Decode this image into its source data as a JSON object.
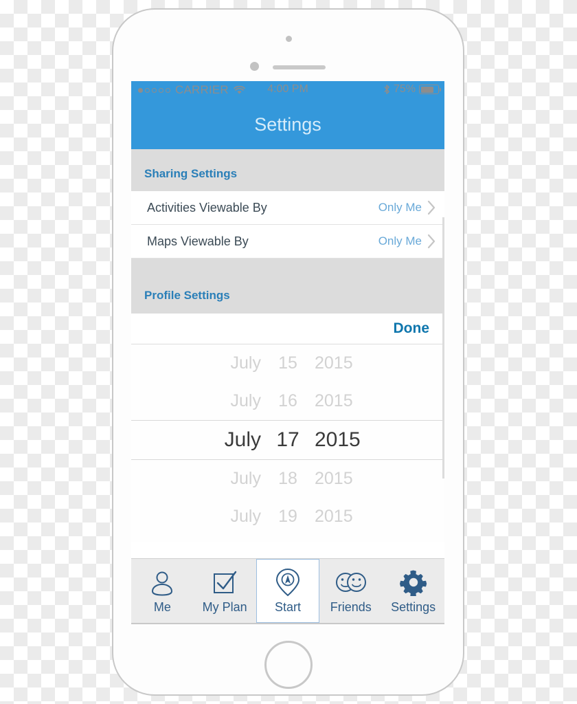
{
  "status_bar": {
    "signal_dots_total": 5,
    "signal_dots_filled": 1,
    "carrier": "CARRIER",
    "wifi_icon": "wifi-icon",
    "time": "4:00 PM",
    "bluetooth_icon": "bluetooth-icon",
    "battery_percent": "75%",
    "battery_level": 75
  },
  "nav": {
    "title": "Settings"
  },
  "sections": {
    "sharing": {
      "header": "Sharing Settings",
      "rows": [
        {
          "label": "Activities Viewable By",
          "value": "Only Me",
          "chevron": "chevron-right-icon"
        },
        {
          "label": "Maps Viewable By",
          "value": "Only Me",
          "chevron": "chevron-right-icon"
        }
      ]
    },
    "profile": {
      "header": "Profile Settings",
      "done_label": "Done"
    }
  },
  "date_picker": {
    "rows": [
      {
        "month": "July",
        "day": "15",
        "year": "2015",
        "selected": false
      },
      {
        "month": "July",
        "day": "16",
        "year": "2015",
        "selected": false
      },
      {
        "month": "July",
        "day": "17",
        "year": "2015",
        "selected": true
      },
      {
        "month": "July",
        "day": "18",
        "year": "2015",
        "selected": false
      },
      {
        "month": "July",
        "day": "19",
        "year": "2015",
        "selected": false
      }
    ],
    "selected_value": "July 17 2015"
  },
  "tab_bar": {
    "tabs": [
      {
        "label": "Me",
        "icon": "person-icon",
        "active": false
      },
      {
        "label": "My Plan",
        "icon": "checkbox-check-icon",
        "active": false
      },
      {
        "label": "Start",
        "icon": "map-pin-compass-icon",
        "active": true
      },
      {
        "label": "Friends",
        "icon": "two-smiley-faces-icon",
        "active": false
      },
      {
        "label": "Settings",
        "icon": "gear-icon",
        "active": false
      }
    ]
  },
  "colors": {
    "nav_blue": "#3498db",
    "section_header_blue": "#2a7fb8",
    "value_blue": "#69a9d8",
    "done_blue": "#0e76ad",
    "tab_blue": "#2f5c87",
    "section_bg_gray": "#dcdcdc",
    "tab_bar_bg": "#ebebeb"
  }
}
